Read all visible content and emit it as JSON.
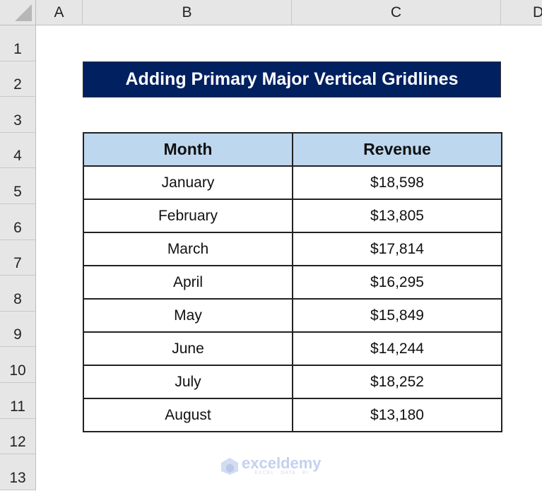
{
  "sheet": {
    "columns": [
      "A",
      "B",
      "C",
      "D"
    ],
    "rows": [
      "1",
      "2",
      "3",
      "4",
      "5",
      "6",
      "7",
      "8",
      "9",
      "10",
      "11",
      "12",
      "13"
    ]
  },
  "title": "Adding Primary Major Vertical Gridlines",
  "table": {
    "headers": [
      "Month",
      "Revenue"
    ],
    "rows": [
      {
        "month": "January",
        "revenue": "$18,598"
      },
      {
        "month": "February",
        "revenue": "$13,805"
      },
      {
        "month": "March",
        "revenue": "$17,814"
      },
      {
        "month": "April",
        "revenue": "$16,295"
      },
      {
        "month": "May",
        "revenue": "$15,849"
      },
      {
        "month": "June",
        "revenue": "$14,244"
      },
      {
        "month": "July",
        "revenue": "$18,252"
      },
      {
        "month": "August",
        "revenue": "$13,180"
      }
    ]
  },
  "watermark": {
    "brand": "exceldemy",
    "tagline": "EXCEL · DATA · BI"
  },
  "colors": {
    "title_bg": "#002060",
    "header_bg": "#bdd7ee"
  }
}
